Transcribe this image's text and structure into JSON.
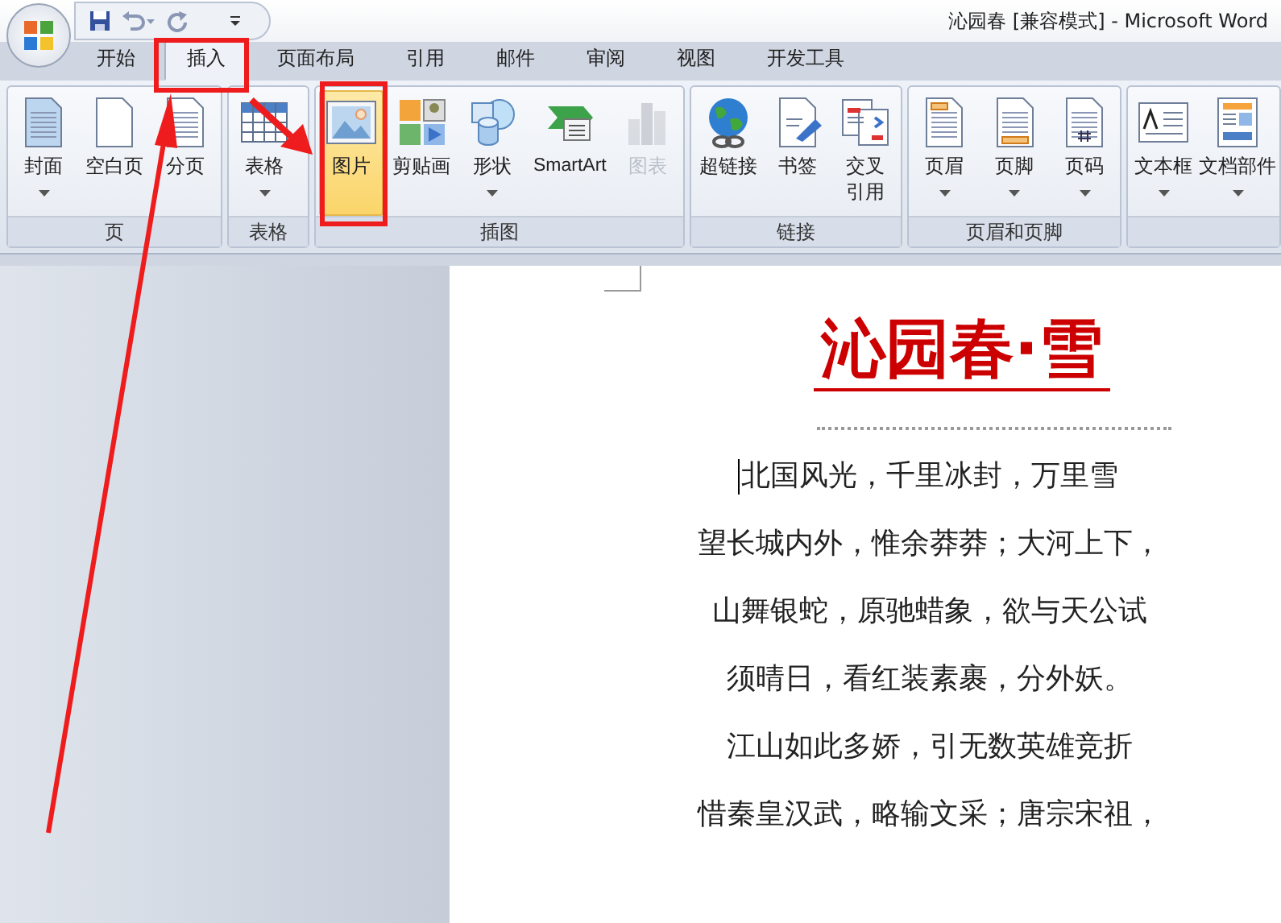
{
  "window": {
    "title": "沁园春 [兼容模式] - Microsoft Word"
  },
  "tabs": [
    {
      "label": "开始",
      "selected": false
    },
    {
      "label": "插入",
      "selected": true
    },
    {
      "label": "页面布局",
      "selected": false
    },
    {
      "label": "引用",
      "selected": false
    },
    {
      "label": "邮件",
      "selected": false
    },
    {
      "label": "审阅",
      "selected": false
    },
    {
      "label": "视图",
      "selected": false
    },
    {
      "label": "开发工具",
      "selected": false
    }
  ],
  "ribbon": {
    "groups": [
      {
        "label": "页",
        "buttons": [
          {
            "label": "封面",
            "kind": "cover",
            "dropdown": true,
            "active": false,
            "disabled": false
          },
          {
            "label": "空白页",
            "kind": "blank",
            "dropdown": false,
            "active": false,
            "disabled": false
          },
          {
            "label": "分页",
            "kind": "pagebreak",
            "dropdown": false,
            "active": false,
            "disabled": false
          }
        ]
      },
      {
        "label": "表格",
        "buttons": [
          {
            "label": "表格",
            "kind": "table",
            "dropdown": true,
            "active": false,
            "disabled": false
          }
        ]
      },
      {
        "label": "插图",
        "buttons": [
          {
            "label": "图片",
            "kind": "picture",
            "dropdown": false,
            "active": true,
            "disabled": false
          },
          {
            "label": "剪贴画",
            "kind": "clipart",
            "dropdown": false,
            "active": false,
            "disabled": false
          },
          {
            "label": "形状",
            "kind": "shapes",
            "dropdown": true,
            "active": false,
            "disabled": false
          },
          {
            "label": "SmartArt",
            "kind": "smartart",
            "dropdown": false,
            "active": false,
            "disabled": false
          },
          {
            "label": "图表",
            "kind": "chart",
            "dropdown": false,
            "active": false,
            "disabled": true
          }
        ]
      },
      {
        "label": "链接",
        "buttons": [
          {
            "label": "超链接",
            "kind": "hyperlink",
            "dropdown": false,
            "active": false,
            "disabled": false
          },
          {
            "label": "书签",
            "kind": "bookmark",
            "dropdown": false,
            "active": false,
            "disabled": false
          },
          {
            "label": "交叉引用",
            "kind": "crossref",
            "dropdown": false,
            "active": false,
            "disabled": false
          }
        ]
      },
      {
        "label": "页眉和页脚",
        "buttons": [
          {
            "label": "页眉",
            "kind": "header",
            "dropdown": true,
            "active": false,
            "disabled": false
          },
          {
            "label": "页脚",
            "kind": "footer",
            "dropdown": true,
            "active": false,
            "disabled": false
          },
          {
            "label": "页码",
            "kind": "pagenum",
            "dropdown": true,
            "active": false,
            "disabled": false
          }
        ]
      },
      {
        "buttons": [
          {
            "label": "文本框",
            "kind": "textbox",
            "dropdown": true,
            "active": false,
            "disabled": false
          },
          {
            "label": "文档部件",
            "kind": "quickparts",
            "dropdown": true,
            "active": false,
            "disabled": false
          }
        ]
      }
    ]
  },
  "document": {
    "title": "沁园春·雪",
    "lines": [
      "北国风光，千里冰封，万里雪",
      "望长城内外，惟余莽莽；大河上下，",
      "山舞银蛇，原驰蜡象，欲与天公试",
      "须晴日，看红装素裹，分外妖。",
      "江山如此多娇，引无数英雄竞折",
      "惜秦皇汉武，略输文采；唐宗宋祖，"
    ]
  }
}
